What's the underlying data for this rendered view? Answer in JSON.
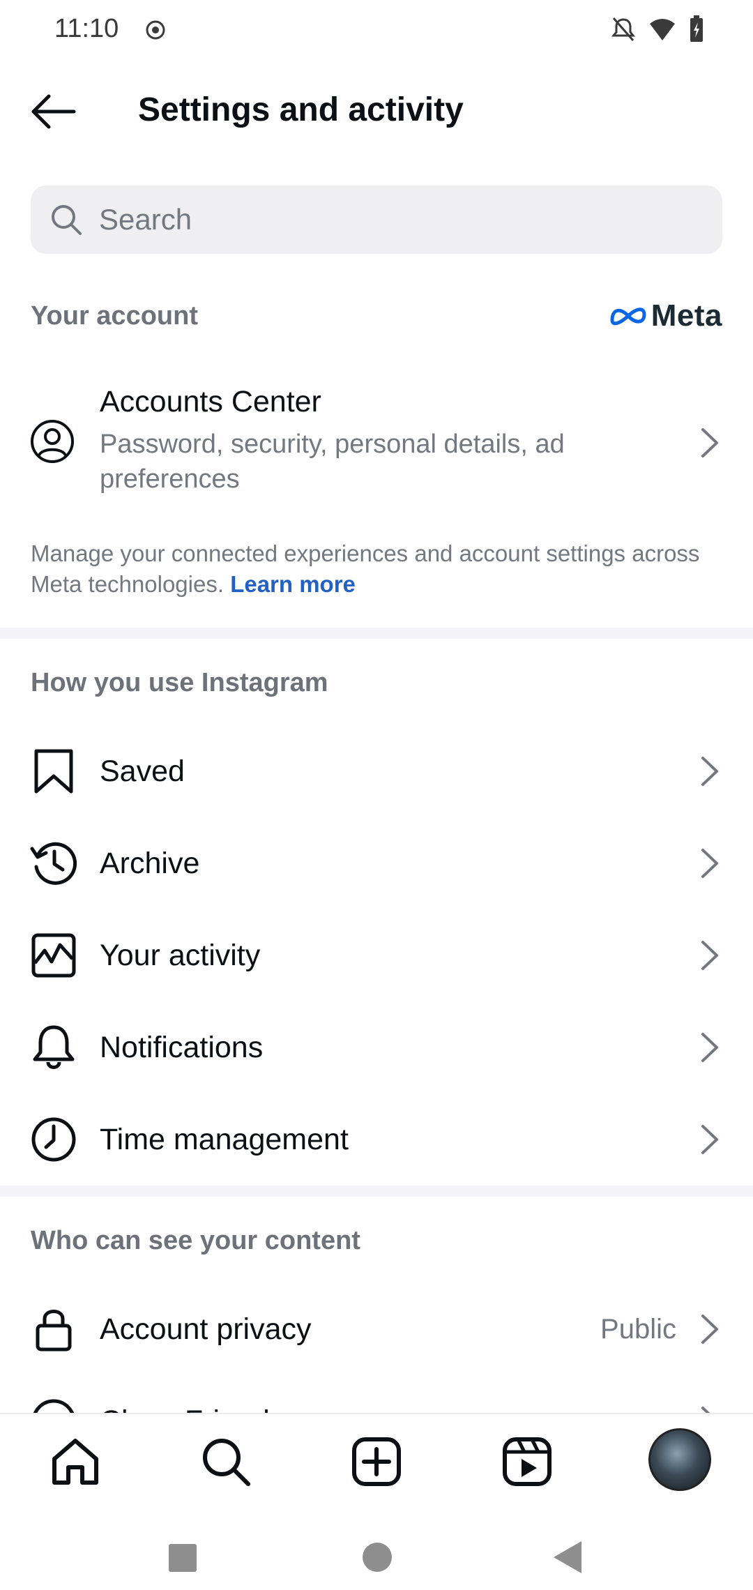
{
  "status": {
    "time": "11:10"
  },
  "header": {
    "title": "Settings and activity"
  },
  "search": {
    "placeholder": "Search"
  },
  "your_account": {
    "label": "Your account",
    "brand": "Meta",
    "accounts_center": {
      "title": "Accounts Center",
      "subtitle": "Password, security, personal details, ad preferences"
    },
    "note": "Manage your connected experiences and account settings across Meta technologies.",
    "learn_more": "Learn more"
  },
  "how_you_use": {
    "label": "How you use Instagram",
    "items": [
      {
        "label": "Saved",
        "icon": "bookmark-icon"
      },
      {
        "label": "Archive",
        "icon": "archive-icon"
      },
      {
        "label": "Your activity",
        "icon": "activity-icon"
      },
      {
        "label": "Notifications",
        "icon": "bell-icon"
      },
      {
        "label": "Time management",
        "icon": "clock-icon"
      }
    ]
  },
  "who_can_see": {
    "label": "Who can see your content",
    "items": [
      {
        "label": "Account privacy",
        "value": "Public",
        "icon": "lock-icon"
      },
      {
        "label": "Close Friends",
        "icon": "star-icon"
      }
    ]
  },
  "colors": {
    "link": "#2360c4",
    "muted": "#737880",
    "text": "#0c1014"
  }
}
